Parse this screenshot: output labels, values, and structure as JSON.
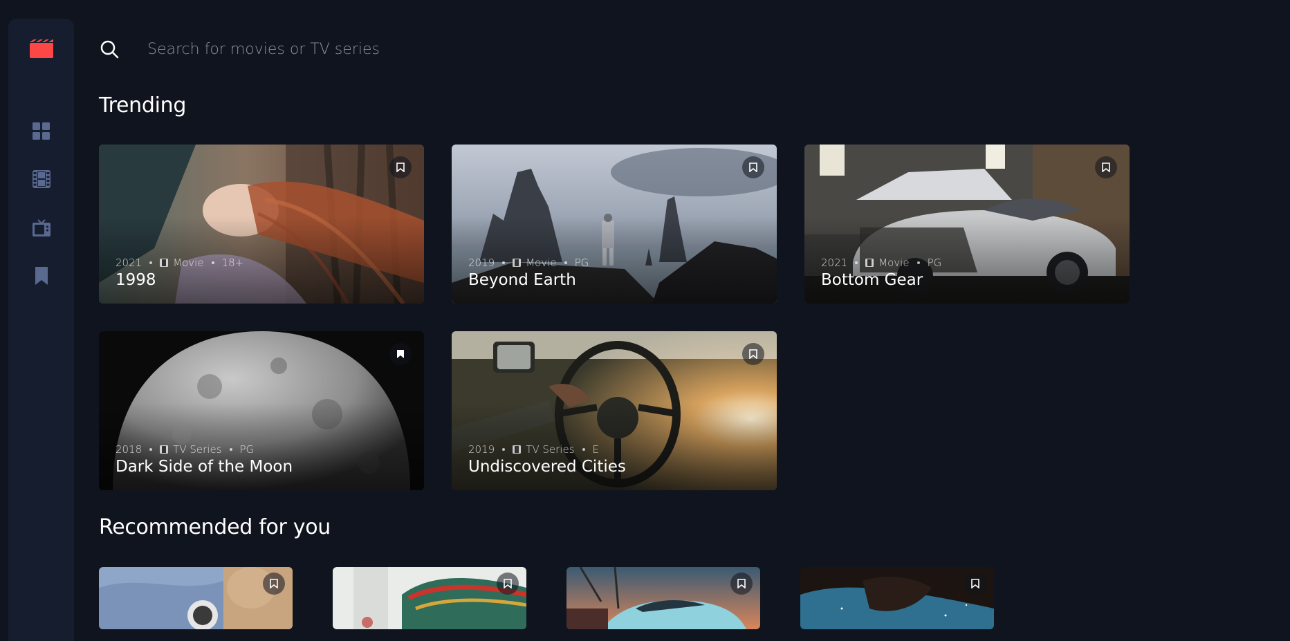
{
  "app": {
    "accent_color": "#fc4747",
    "background_color": "#10141e",
    "sidebar_color": "#161d2f",
    "nav": [
      {
        "id": "home",
        "icon": "grid-icon",
        "label": "Home"
      },
      {
        "id": "movies",
        "icon": "film-icon",
        "label": "Movies"
      },
      {
        "id": "tv",
        "icon": "tv-icon",
        "label": "TV Series"
      },
      {
        "id": "bookmarks",
        "icon": "bookmark-icon",
        "label": "Bookmarks"
      }
    ]
  },
  "search": {
    "placeholder": "Search for movies or TV series"
  },
  "trending": {
    "heading": "Trending",
    "items": [
      {
        "year": "2021",
        "category": "Movie",
        "rating": "18+",
        "title": "1998",
        "bookmarked": false
      },
      {
        "year": "2019",
        "category": "Movie",
        "rating": "PG",
        "title": "Beyond Earth",
        "bookmarked": false
      },
      {
        "year": "2021",
        "category": "Movie",
        "rating": "PG",
        "title": "Bottom Gear",
        "bookmarked": false
      },
      {
        "year": "2018",
        "category": "TV Series",
        "rating": "PG",
        "title": "Dark Side of the Moon",
        "bookmarked": true
      },
      {
        "year": "2019",
        "category": "TV Series",
        "rating": "E",
        "title": "Undiscovered Cities",
        "bookmarked": false
      }
    ]
  },
  "recommended": {
    "heading": "Recommended for you"
  }
}
